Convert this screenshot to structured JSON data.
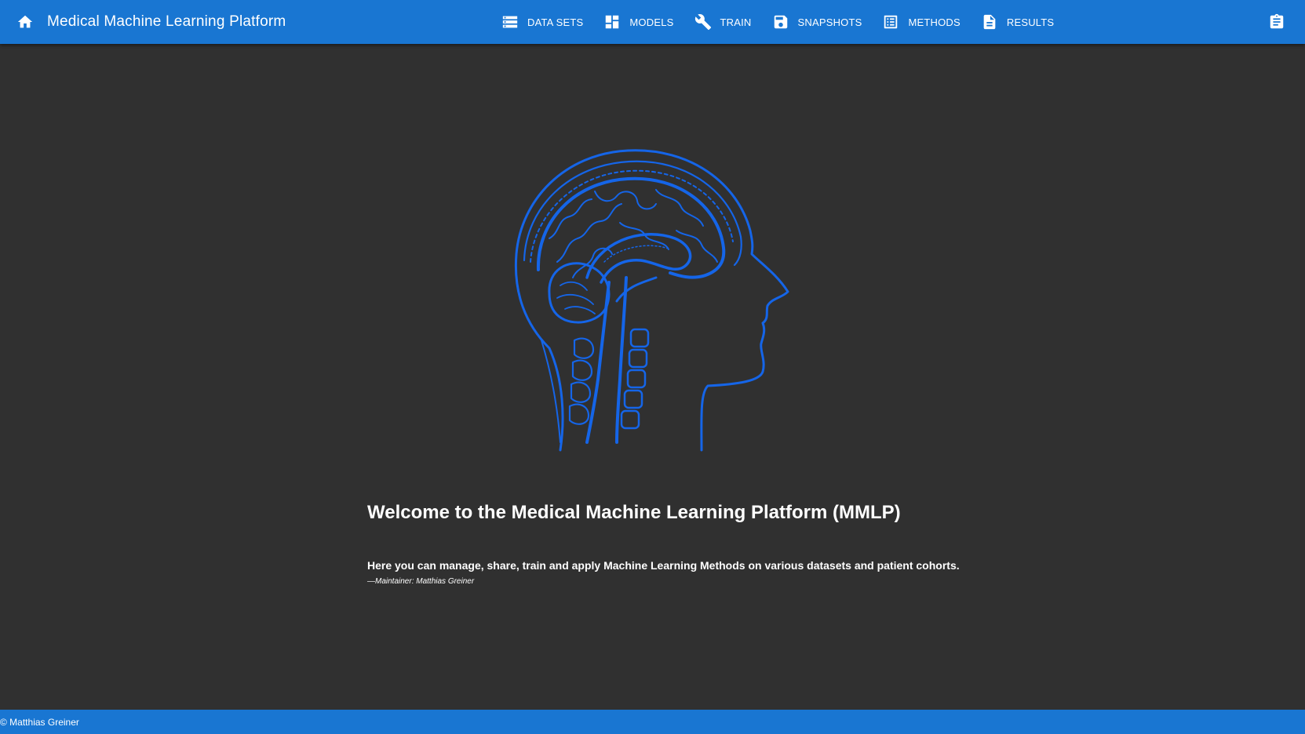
{
  "header": {
    "title": "Medical Machine Learning Platform",
    "home_icon": "home-icon",
    "right_icon": "clipboard-icon"
  },
  "nav": [
    {
      "label": "DATA SETS",
      "icon": "storage-icon"
    },
    {
      "label": "MODELS",
      "icon": "dashboard-icon"
    },
    {
      "label": "TRAIN",
      "icon": "wrench-icon"
    },
    {
      "label": "SNAPSHOTS",
      "icon": "save-icon"
    },
    {
      "label": "METHODS",
      "icon": "list-alt-icon"
    },
    {
      "label": "RESULTS",
      "icon": "description-icon"
    }
  ],
  "main": {
    "illustration": "brain-head-illustration",
    "welcome": "Welcome to the Medical Machine Learning Platform (MMLP)",
    "quote": "Here you can manage, share, train and apply Machine Learning Methods on various datasets and patient cohorts.",
    "maintainer": "—Maintainer: Matthias Greiner"
  },
  "footer": {
    "text": "© Matthias Greiner"
  },
  "colors": {
    "primary": "#1976d2",
    "background": "#303030",
    "illustration": "#1565e8"
  }
}
